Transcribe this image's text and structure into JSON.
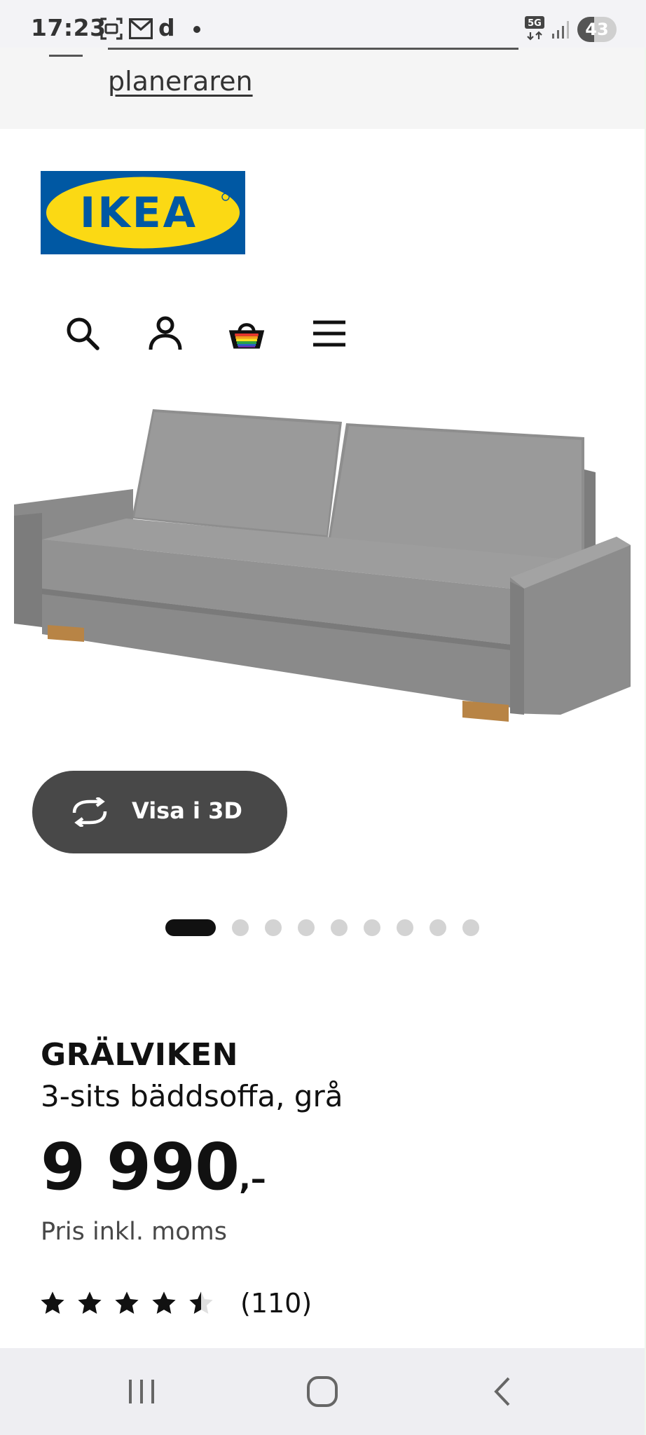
{
  "status_bar": {
    "time": "17:23",
    "network": "5G",
    "battery_level": 0.43,
    "battery_label": "43",
    "icons": [
      "screenshot-icon",
      "mail-icon",
      "d-app-icon",
      "notification-dot-icon",
      "5g-icon",
      "signal-icon",
      "battery-icon"
    ],
    "app_letter": "d"
  },
  "banner": {
    "link_label": "planeraren"
  },
  "header": {
    "logo_text": "IKEA",
    "colors": {
      "logo_blue": "#0058a3",
      "logo_yellow": "#fbd914"
    },
    "icons": [
      "search-icon",
      "account-icon",
      "basket-icon",
      "menu-icon"
    ]
  },
  "product": {
    "image_alt": "Gray sofa",
    "view_3d_label": "Visa i 3D",
    "carousel": {
      "total": 9,
      "active_index": 0
    },
    "name": "GRÄLVIKEN",
    "description": "3-sits bäddsoffa, grå",
    "price_main": "9 990",
    "price_suffix": ",–",
    "price_note": "Pris inkl. moms",
    "rating": {
      "stars": 4.5,
      "max": 5,
      "count_label": "(110)"
    }
  },
  "nav_bar": {
    "buttons": [
      "recent-apps-icon",
      "home-icon",
      "back-icon"
    ]
  }
}
